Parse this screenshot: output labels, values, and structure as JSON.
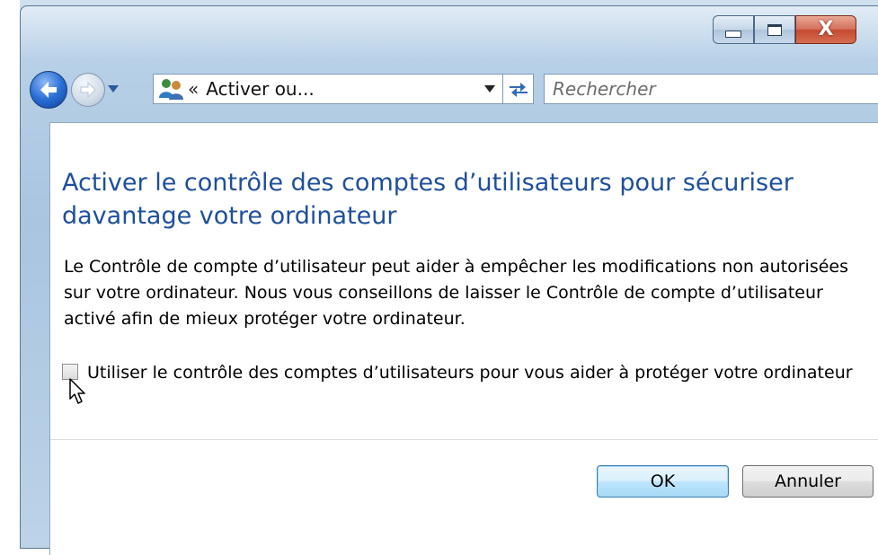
{
  "window": {
    "caption": {
      "minimize_icon": "minimize-icon",
      "maximize_icon": "maximize-icon",
      "close_glyph": "X"
    }
  },
  "navbar": {
    "address_prefix": "«",
    "address_text": "Activer ou...",
    "search_placeholder": "Rechercher"
  },
  "content": {
    "title": "Activer le contrôle des comptes d’utilisateurs pour sécuriser davantage votre ordinateur",
    "description": "Le Contrôle de compte d’utilisateur peut aider à empêcher les modifications non autorisées sur votre ordinateur. Nous vous conseillons de laisser le Contrôle de compte d’utilisateur activé afin de mieux protéger votre ordinateur.",
    "checkbox_label": "Utiliser le contrôle des comptes d’utilisateurs pour vous aider à protéger votre ordinateur",
    "checkbox_checked": false
  },
  "buttons": {
    "ok": "OK",
    "cancel": "Annuler"
  },
  "colors": {
    "title": "#1e4f9c",
    "frame": "#bcd4ea",
    "close": "#c44a30"
  }
}
